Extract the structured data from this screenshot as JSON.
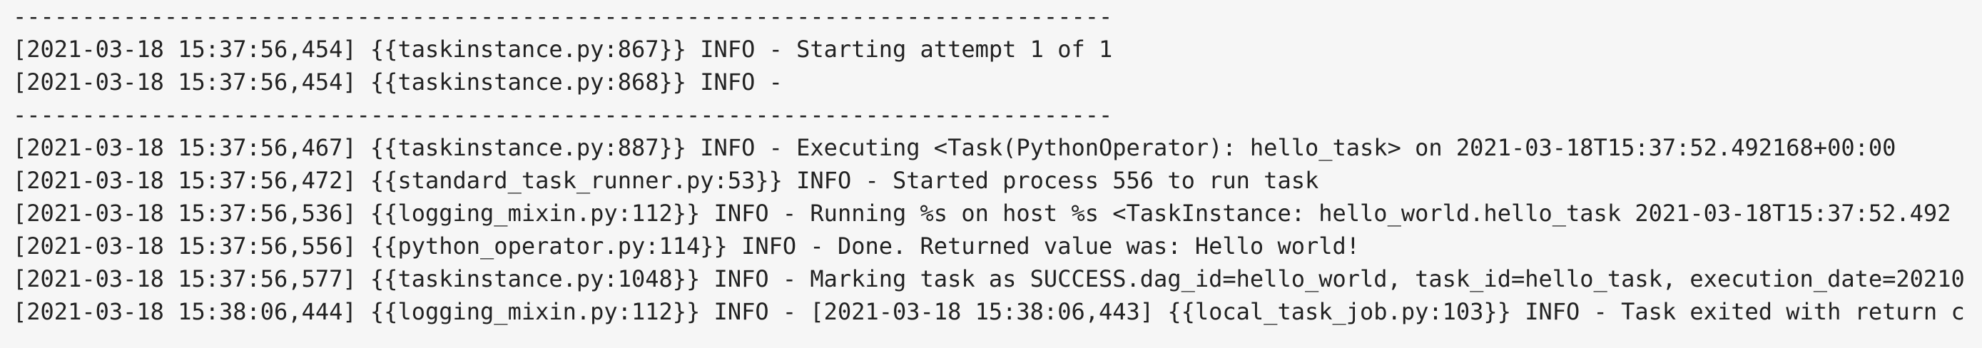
{
  "log": {
    "lines": [
      "--------------------------------------------------------------------------------",
      "[2021-03-18 15:37:56,454] {{taskinstance.py:867}} INFO - Starting attempt 1 of 1",
      "[2021-03-18 15:37:56,454] {{taskinstance.py:868}} INFO - ",
      "--------------------------------------------------------------------------------",
      "[2021-03-18 15:37:56,467] {{taskinstance.py:887}} INFO - Executing <Task(PythonOperator): hello_task> on 2021-03-18T15:37:52.492168+00:00",
      "[2021-03-18 15:37:56,472] {{standard_task_runner.py:53}} INFO - Started process 556 to run task",
      "[2021-03-18 15:37:56,536] {{logging_mixin.py:112}} INFO - Running %s on host %s <TaskInstance: hello_world.hello_task 2021-03-18T15:37:52.492",
      "[2021-03-18 15:37:56,556] {{python_operator.py:114}} INFO - Done. Returned value was: Hello world!",
      "[2021-03-18 15:37:56,577] {{taskinstance.py:1048}} INFO - Marking task as SUCCESS.dag_id=hello_world, task_id=hello_task, execution_date=20210",
      "[2021-03-18 15:38:06,444] {{logging_mixin.py:112}} INFO - [2021-03-18 15:38:06,443] {{local_task_job.py:103}} INFO - Task exited with return c"
    ]
  }
}
